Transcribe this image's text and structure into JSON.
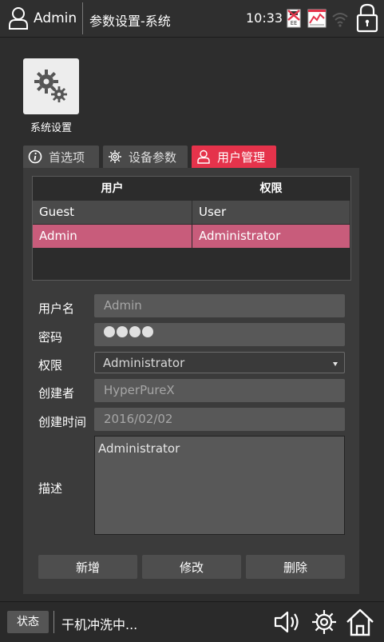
{
  "header": {
    "username": "Admin",
    "title": "参数设置-系统",
    "time": "10:33",
    "usb_badge": "EE"
  },
  "app": {
    "label": "系统设置"
  },
  "tabs": [
    {
      "label": "首选项",
      "icon": "info-icon",
      "active": false
    },
    {
      "label": "设备参数",
      "icon": "gear-icon",
      "active": false
    },
    {
      "label": "用户管理",
      "icon": "user-icon",
      "active": true
    }
  ],
  "user_table": {
    "headers": [
      "用户",
      "权限"
    ],
    "rows": [
      {
        "user": "Guest",
        "role": "User"
      },
      {
        "user": "Admin",
        "role": "Administrator",
        "selected": true
      }
    ]
  },
  "form": {
    "username_label": "用户名",
    "username_value": "Admin",
    "password_label": "密码",
    "role_label": "权限",
    "role_value": "Administrator",
    "creator_label": "创建者",
    "creator_value": "HyperPureX",
    "created_label": "创建时间",
    "created_value": "2016/02/02",
    "desc_label": "描述",
    "desc_value": "Administrator"
  },
  "buttons": {
    "add": "新增",
    "edit": "修改",
    "delete": "删除"
  },
  "statusbar": {
    "badge": "状态",
    "message": "干机冲洗中..."
  },
  "colors": {
    "accent": "#e5334b",
    "selected_row": "#c85c7b",
    "background": "#2d2d2d"
  }
}
